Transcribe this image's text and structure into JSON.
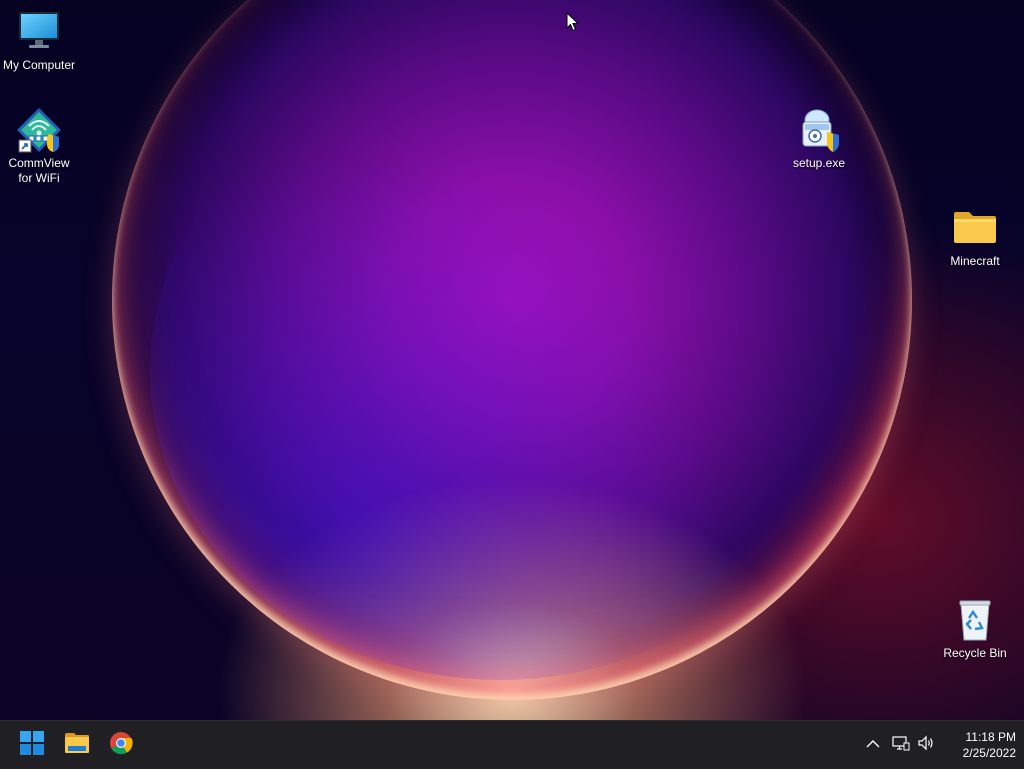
{
  "desktop": {
    "icons": [
      {
        "label": "My Computer",
        "icon": "monitor-icon"
      },
      {
        "label": "CommView for WiFi",
        "label_lines": [
          "CommView",
          "for WiFi"
        ],
        "icon": "commview-icon"
      },
      {
        "label": "setup.exe",
        "icon": "installer-icon"
      },
      {
        "label": "Minecraft",
        "icon": "folder-icon"
      },
      {
        "label": "Recycle Bin",
        "icon": "recycle-bin-icon"
      }
    ]
  },
  "taskbar": {
    "pinned": [
      {
        "name": "Start",
        "icon": "windows-start-icon"
      },
      {
        "name": "File Explorer",
        "icon": "file-explorer-icon"
      },
      {
        "name": "Google Chrome",
        "icon": "chrome-icon"
      }
    ],
    "tray": {
      "icons": [
        "chevron-up-icon",
        "network-icon",
        "volume-icon"
      ]
    },
    "clock": {
      "time": "11:18 PM",
      "date": "2/25/2022"
    }
  },
  "colors": {
    "taskbar_bg": "#1f1f24",
    "accent_blue": "#1e90e8",
    "folder_yellow": "#f8c94a"
  }
}
